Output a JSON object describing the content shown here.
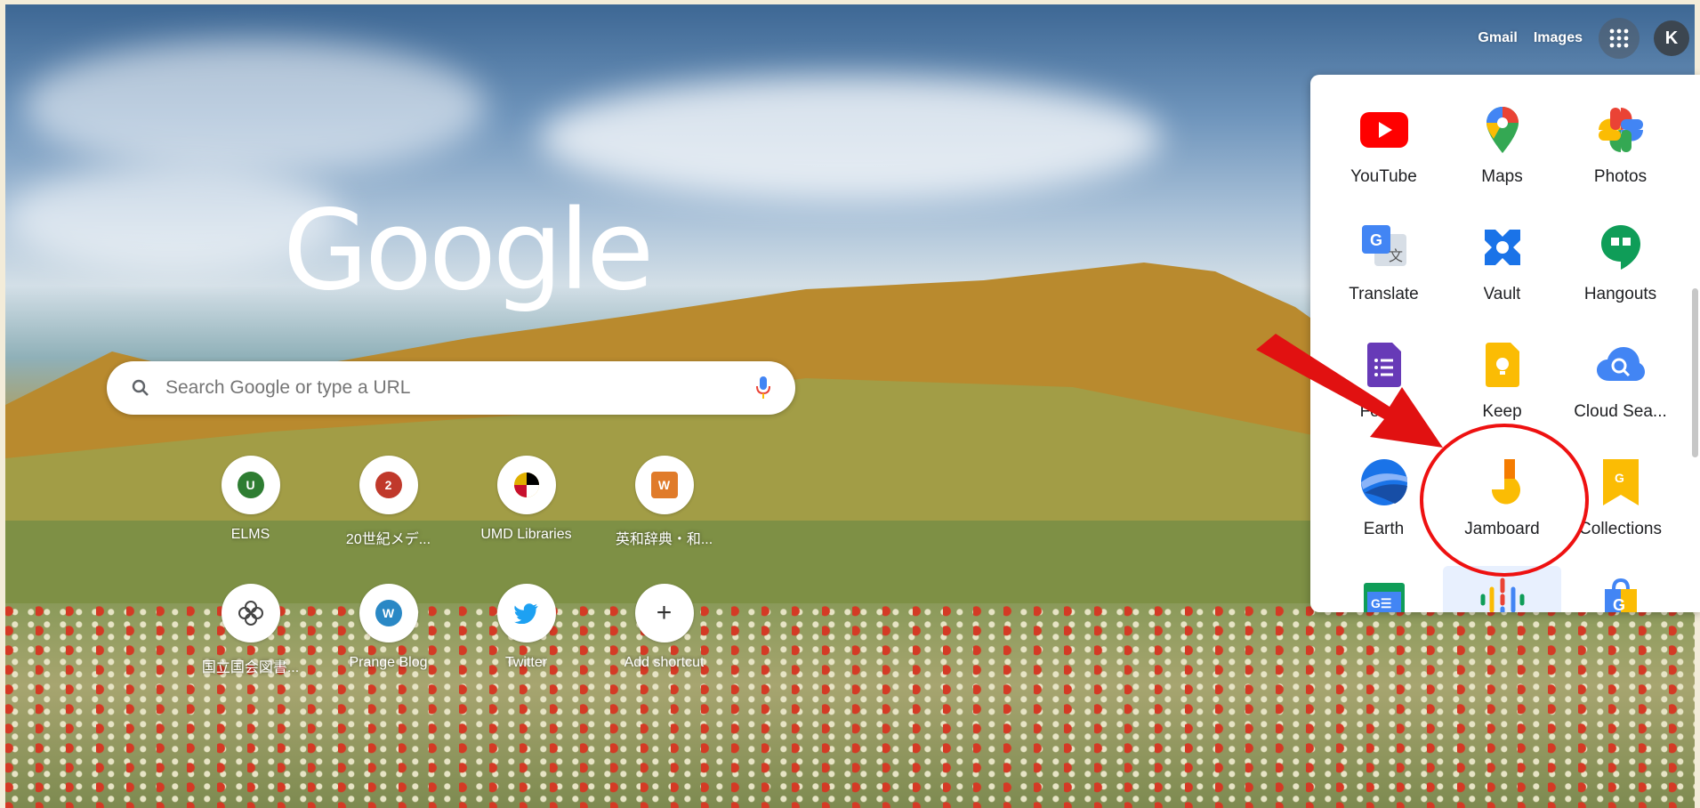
{
  "topbar": {
    "gmail": "Gmail",
    "images": "Images",
    "avatar_letter": "K"
  },
  "logo": "Google",
  "search": {
    "placeholder": "Search Google or type a URL"
  },
  "shortcuts": [
    {
      "label": "ELMS",
      "glyph": "U",
      "color": "#2e7d32"
    },
    {
      "label": "20世紀メデ...",
      "glyph": "2",
      "color": "#c0392b"
    },
    {
      "label": "UMD Libraries",
      "glyph": "",
      "color": "#e0b000"
    },
    {
      "label": "英和辞典・和...",
      "glyph": "W",
      "color": "#e07b2a"
    },
    {
      "label": "国立国会図書...",
      "glyph": "",
      "color": "#555555"
    },
    {
      "label": "Prange Blog",
      "glyph": "W",
      "color": "#2a88c5"
    },
    {
      "label": "Twitter",
      "glyph": "",
      "color": "#1da1f2"
    },
    {
      "label": "Add shortcut",
      "glyph": "+",
      "color": "#333333"
    }
  ],
  "apps": [
    {
      "label": "YouTube",
      "icon": "youtube-icon"
    },
    {
      "label": "Maps",
      "icon": "maps-icon"
    },
    {
      "label": "Photos",
      "icon": "photos-icon"
    },
    {
      "label": "Translate",
      "icon": "translate-icon"
    },
    {
      "label": "Vault",
      "icon": "vault-icon"
    },
    {
      "label": "Hangouts",
      "icon": "hangouts-icon"
    },
    {
      "label": "Forms",
      "icon": "forms-icon"
    },
    {
      "label": "Keep",
      "icon": "keep-icon"
    },
    {
      "label": "Cloud Sea...",
      "icon": "cloud-search-icon"
    },
    {
      "label": "Earth",
      "icon": "earth-icon"
    },
    {
      "label": "Jamboard",
      "icon": "jamboard-icon"
    },
    {
      "label": "Collections",
      "icon": "collections-icon"
    },
    {
      "label": "",
      "icon": "classroom-icon"
    },
    {
      "label": "",
      "icon": "podcasts-icon"
    },
    {
      "label": "",
      "icon": "shopping-icon"
    }
  ],
  "colors": {
    "annotation": "#e11111",
    "youtube": "#ff0000",
    "vault": "#1a73e8",
    "hangouts": "#0f9d58",
    "keep": "#fbbc04"
  }
}
